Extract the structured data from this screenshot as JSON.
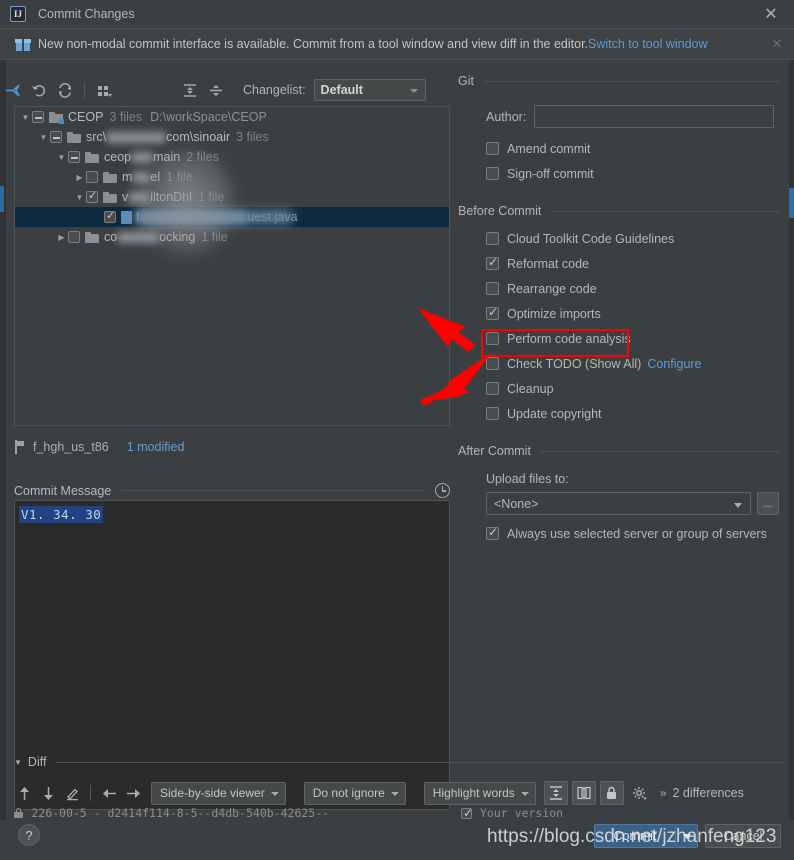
{
  "window": {
    "title": "Commit Changes",
    "app_icon": "IJ",
    "close_label": "✕"
  },
  "banner": {
    "icon": "gift-icon",
    "text": "New non-modal commit interface is available. Commit from a tool window and view diff in the editor.",
    "link": "Switch to tool window",
    "close": "✕"
  },
  "left_pane": {
    "toolbar": {
      "icons": [
        {
          "name": "move-to-changelist-icon",
          "title": "Move to Another Changelist"
        },
        {
          "name": "rollback-icon",
          "title": "Rollback"
        },
        {
          "name": "refresh-icon",
          "title": "Refresh"
        },
        {
          "name": "group-by-icon",
          "title": "Group By"
        },
        {
          "name": "expand-all-icon",
          "title": "Expand All"
        },
        {
          "name": "collapse-all-icon",
          "title": "Collapse All"
        }
      ],
      "changelist_label": "Changelist:",
      "changelist_value": "Default"
    },
    "tree": [
      {
        "indent": 0,
        "twisty": "▼",
        "check": "partial",
        "icon": "folder-modified",
        "name": "CEOP",
        "meta": "3 files",
        "path": "D:\\workSpace\\CEOP",
        "blurred": false,
        "selected": false
      },
      {
        "indent": 1,
        "twisty": "▼",
        "check": "partial",
        "icon": "folder",
        "name_prefix": "src\\",
        "name_blur": true,
        "name_suffix": "com\\sinoair",
        "meta": "3 files",
        "path": "",
        "selected": false
      },
      {
        "indent": 2,
        "twisty": "▼",
        "check": "partial",
        "icon": "folder",
        "name_prefix": "ceop",
        "name_blur": true,
        "name_suffix": "main",
        "meta": "2 files",
        "path": "",
        "selected": false
      },
      {
        "indent": 3,
        "twisty": "▶",
        "check": "unchecked",
        "icon": "folder",
        "name_prefix": "m",
        "name_blur": true,
        "name_suffix": "el",
        "meta": "1 file",
        "path": "",
        "selected": false
      },
      {
        "indent": 3,
        "twisty": "▼",
        "check": "checked",
        "icon": "folder",
        "name_prefix": "v",
        "name_blur": true,
        "name_suffix": "iltonDhl",
        "meta": "1 file",
        "path": "",
        "selected": false
      },
      {
        "indent": 4,
        "twisty": "",
        "check": "checked",
        "icon": "file",
        "name_prefix": "f",
        "name_blur": true,
        "name_suffix": "uest.java",
        "meta": "",
        "path": "",
        "selected": true
      },
      {
        "indent": 2,
        "twisty": "▶",
        "check": "unchecked",
        "icon": "folder",
        "name_prefix": "co",
        "name_blur": true,
        "name_suffix": "ocking",
        "meta": "1 file",
        "path": "",
        "selected": false
      }
    ],
    "branch": {
      "icon": "branch-icon",
      "name": "f_hgh_us_t86",
      "status": "1 modified"
    },
    "commit_message": {
      "label": "Commit Message",
      "history_icon": "clock-icon",
      "value": "V1. 34. 30"
    }
  },
  "right_pane": {
    "git_group": {
      "title": "Git",
      "author_label": "Author:",
      "author_value": "",
      "checkboxes": [
        {
          "name": "amend-commit",
          "label": "Amend commit",
          "checked": false
        },
        {
          "name": "sign-off-commit",
          "label": "Sign-off commit",
          "checked": false
        }
      ]
    },
    "before_commit": {
      "title": "Before Commit",
      "checkboxes": [
        {
          "name": "cloud-toolkit-code-guidelines",
          "label": "Cloud Toolkit Code Guidelines",
          "checked": false,
          "link": ""
        },
        {
          "name": "reformat-code",
          "label": "Reformat code",
          "checked": true,
          "link": ""
        },
        {
          "name": "rearrange-code",
          "label": "Rearrange code",
          "checked": false,
          "link": ""
        },
        {
          "name": "optimize-imports",
          "label": "Optimize imports",
          "checked": true,
          "link": "",
          "highlighted": true
        },
        {
          "name": "perform-code-analysis",
          "label": "Perform code analysis",
          "checked": false,
          "link": ""
        },
        {
          "name": "check-todo",
          "label": "Check TODO (Show All)",
          "checked": false,
          "link": "Configure"
        },
        {
          "name": "cleanup",
          "label": "Cleanup",
          "checked": false,
          "link": ""
        },
        {
          "name": "update-copyright",
          "label": "Update copyright",
          "checked": false,
          "link": ""
        }
      ]
    },
    "after_commit": {
      "title": "After Commit",
      "upload_label": "Upload files to:",
      "upload_value": "<None>",
      "browse_label": "...",
      "always_use_label": "Always use selected server or group of servers",
      "always_use_checked": true
    }
  },
  "diff": {
    "title": "Diff",
    "twisty": "▼",
    "toolbar": {
      "icons": [
        {
          "name": "previous-difference-icon",
          "glyph": "↑"
        },
        {
          "name": "next-difference-icon",
          "glyph": "↓"
        },
        {
          "name": "edit-source-icon",
          "glyph": "✎"
        },
        {
          "name": "accept-left-icon",
          "glyph": "←"
        },
        {
          "name": "accept-right-icon",
          "glyph": "→"
        }
      ],
      "viewer_mode": "Side-by-side viewer",
      "ignore_policy": "Do not ignore",
      "highlight_policy": "Highlight words",
      "toggle_icons": [
        {
          "name": "collapse-unchanged-icon",
          "active": true
        },
        {
          "name": "sync-scroll-icon",
          "active": true
        },
        {
          "name": "read-only-lock-icon",
          "active": true
        },
        {
          "name": "diff-settings-gear-icon",
          "active": false
        }
      ],
      "overflow": "»",
      "differences_count": "2 differences"
    },
    "revision_left": "226-00-5 - d2414f114-8-5--d4db-540b-42625--",
    "revision_right": "Your version"
  },
  "footer": {
    "help_label": "?",
    "commit_label": "Commit",
    "commit_dropdown": "▼",
    "cancel_label": "Cancel"
  },
  "annotations": {
    "highlight_color": "#ff0000",
    "watermark": "https://blog.csdn.net/jzhanfeng123"
  }
}
